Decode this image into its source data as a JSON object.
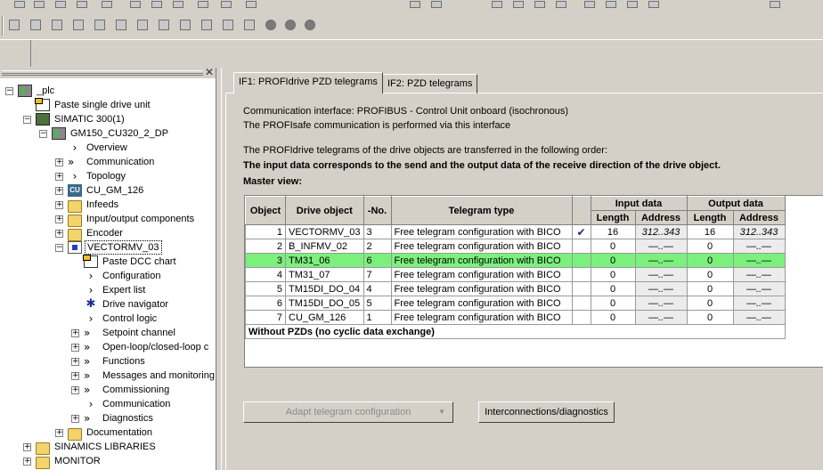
{
  "tree": {
    "items": [
      {
        "label": "_plc",
        "level": 0,
        "expander": "-",
        "icon": "project-icon"
      },
      {
        "label": "Paste single drive unit",
        "level": 1,
        "expander": "",
        "icon": "paste-icon"
      },
      {
        "label": "SIMATIC 300(1)",
        "level": 1,
        "expander": "-",
        "icon": "station-icon"
      },
      {
        "label": "GM150_CU320_2_DP",
        "level": 2,
        "expander": "-",
        "icon": "drive-unit-icon"
      },
      {
        "label": "Overview",
        "level": 3,
        "expander": "",
        "icon": "chevron-icon"
      },
      {
        "label": "Communication",
        "level": 3,
        "expander": "+",
        "icon": "double-chevron-icon"
      },
      {
        "label": "Topology",
        "level": 3,
        "expander": "+",
        "icon": "chevron-icon"
      },
      {
        "label": "CU_GM_126",
        "level": 3,
        "expander": "+",
        "icon": "cu-icon"
      },
      {
        "label": "Infeeds",
        "level": 3,
        "expander": "+",
        "icon": "folder-icon"
      },
      {
        "label": "Input/output components",
        "level": 3,
        "expander": "+",
        "icon": "folder-icon"
      },
      {
        "label": "Encoder",
        "level": 3,
        "expander": "+",
        "icon": "folder-icon"
      },
      {
        "label": "VECTORMV_03",
        "level": 3,
        "expander": "-",
        "icon": "drive-object-icon",
        "selected": true
      },
      {
        "label": "Paste DCC chart",
        "level": 4,
        "expander": "",
        "icon": "paste-icon"
      },
      {
        "label": "Configuration",
        "level": 4,
        "expander": "",
        "icon": "chevron-icon"
      },
      {
        "label": "Expert list",
        "level": 4,
        "expander": "",
        "icon": "chevron-icon"
      },
      {
        "label": "Drive navigator",
        "level": 4,
        "expander": "",
        "icon": "navigator-icon"
      },
      {
        "label": "Control logic",
        "level": 4,
        "expander": "",
        "icon": "chevron-icon"
      },
      {
        "label": "Setpoint channel",
        "level": 4,
        "expander": "+",
        "icon": "double-chevron-icon"
      },
      {
        "label": "Open-loop/closed-loop c",
        "level": 4,
        "expander": "+",
        "icon": "double-chevron-icon"
      },
      {
        "label": "Functions",
        "level": 4,
        "expander": "+",
        "icon": "double-chevron-icon"
      },
      {
        "label": "Messages and monitoring",
        "level": 4,
        "expander": "+",
        "icon": "double-chevron-icon"
      },
      {
        "label": "Commissioning",
        "level": 4,
        "expander": "+",
        "icon": "double-chevron-icon"
      },
      {
        "label": "Communication",
        "level": 4,
        "expander": "",
        "icon": "chevron-icon"
      },
      {
        "label": "Diagnostics",
        "level": 4,
        "expander": "+",
        "icon": "double-chevron-icon"
      },
      {
        "label": "Documentation",
        "level": 3,
        "expander": "+",
        "icon": "folder-icon"
      },
      {
        "label": "SINAMICS LIBRARIES",
        "level": 1,
        "expander": "+",
        "icon": "folder-icon"
      },
      {
        "label": "MONITOR",
        "level": 1,
        "expander": "+",
        "icon": "folder-icon"
      }
    ]
  },
  "tabs": [
    {
      "label": "IF1:  PROFIdrive  PZD telegrams",
      "active": true
    },
    {
      "label": "IF2:  PZD telegrams",
      "active": false
    }
  ],
  "info": {
    "line1": "Communication interface: PROFIBUS - Control Unit onboard (isochronous)",
    "line2": "The PROFIsafe communication is performed via this interface",
    "line3": "The PROFIdrive telegrams of the drive objects are transferred in the following order:",
    "line4": "The input data corresponds to the send and the output data of the receive direction of the drive object.",
    "master_view": "Master view:"
  },
  "table": {
    "headers": {
      "object": "Object",
      "drive_object": "Drive object",
      "no": "-No.",
      "telegram_type": "Telegram type",
      "input_data": "Input data",
      "output_data": "Output data",
      "length": "Length",
      "address": "Address"
    },
    "rows": [
      {
        "object": "1",
        "drive_object": "VECTORMV_03",
        "no": "3",
        "telegram": "Free telegram configuration with BICO",
        "check": "✔",
        "in_len": "16",
        "in_addr": "312..343",
        "out_len": "16",
        "out_addr": "312..343"
      },
      {
        "object": "2",
        "drive_object": "B_INFMV_02",
        "no": "2",
        "telegram": "Free telegram configuration with BICO",
        "check": "",
        "in_len": "0",
        "in_addr": "—..—",
        "out_len": "0",
        "out_addr": "—..—"
      },
      {
        "object": "3",
        "drive_object": "TM31_06",
        "no": "6",
        "telegram": "Free telegram configuration with BICO",
        "check": "",
        "in_len": "0",
        "in_addr": "—..—",
        "out_len": "0",
        "out_addr": "—..—",
        "highlight": true
      },
      {
        "object": "4",
        "drive_object": "TM31_07",
        "no": "7",
        "telegram": "Free telegram configuration with BICO",
        "check": "",
        "in_len": "0",
        "in_addr": "—..—",
        "out_len": "0",
        "out_addr": "—..—"
      },
      {
        "object": "5",
        "drive_object": "TM15DI_DO_04",
        "no": "4",
        "telegram": "Free telegram configuration with BICO",
        "check": "",
        "in_len": "0",
        "in_addr": "—..—",
        "out_len": "0",
        "out_addr": "—..—"
      },
      {
        "object": "6",
        "drive_object": "TM15DI_DO_05",
        "no": "5",
        "telegram": "Free telegram configuration with BICO",
        "check": "",
        "in_len": "0",
        "in_addr": "—..—",
        "out_len": "0",
        "out_addr": "—..—"
      },
      {
        "object": "7",
        "drive_object": "CU_GM_126",
        "no": "1",
        "telegram": "Free telegram configuration with BICO",
        "check": "",
        "in_len": "0",
        "in_addr": "—..—",
        "out_len": "0",
        "out_addr": "—..—"
      }
    ],
    "footer": "Without PZDs (no cyclic data exchange)"
  },
  "buttons": {
    "adapt": "Adapt telegram configuration",
    "interconnections": "Interconnections/diagnostics"
  },
  "colors": {
    "highlight_row": "#7cf07c",
    "window_bg": "#d4d0c8"
  }
}
